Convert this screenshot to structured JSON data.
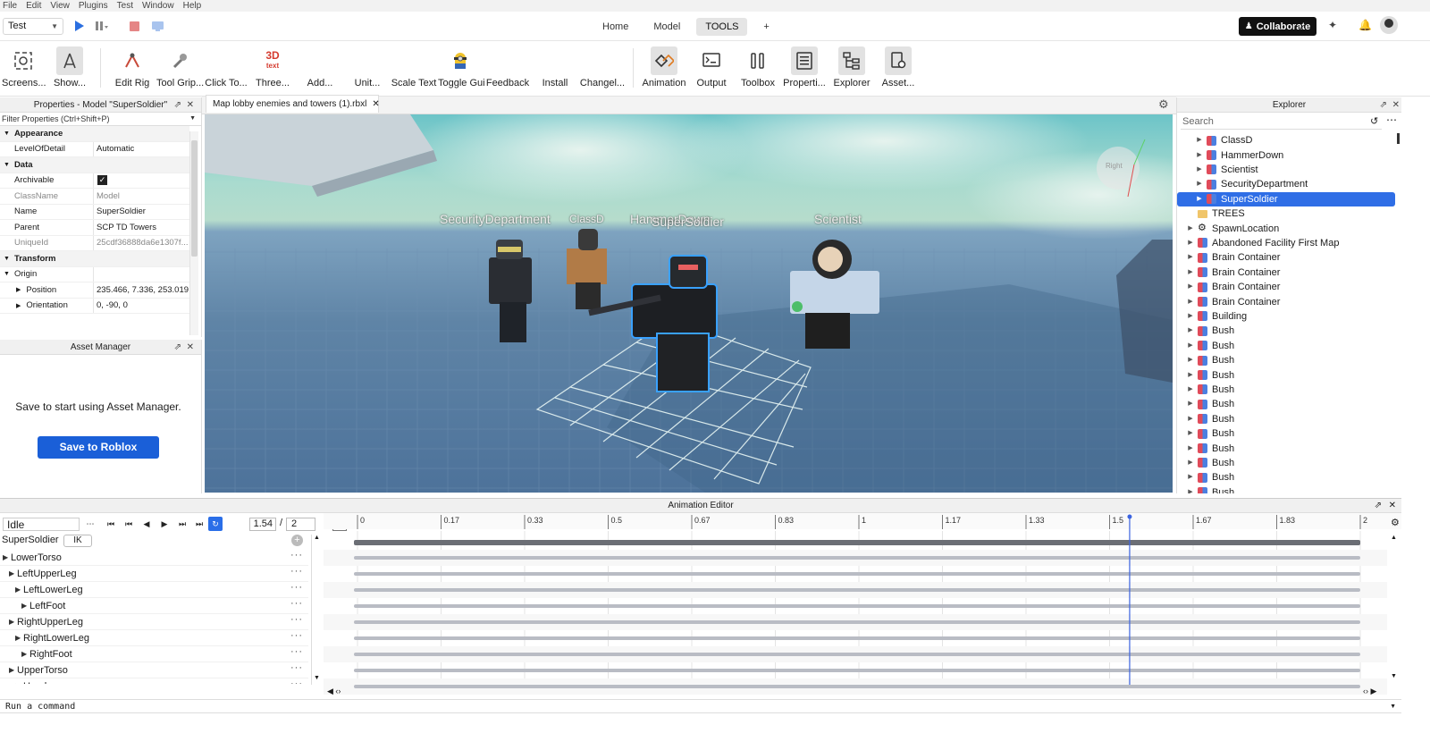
{
  "menu": [
    "File",
    "Edit",
    "View",
    "Plugins",
    "Test",
    "Window",
    "Help"
  ],
  "header": {
    "mode": "Test",
    "tabs": [
      "Home",
      "Model",
      "TOOLS",
      "+"
    ],
    "collaborate": "Collaborate"
  },
  "ribbon": [
    "Screens...",
    "Show...",
    "Edit Rig",
    "Tool Grip...",
    "Click To...",
    "Three...",
    "Add...",
    "Unit...",
    "Scale Text",
    "Toggle Gui",
    "Feedback",
    "Install",
    "Changel...",
    "Animation",
    "Output",
    "Toolbox",
    "Properti...",
    "Explorer",
    "Asset..."
  ],
  "properties": {
    "title": "Properties - Model \"SuperSoldier\"",
    "filter": "Filter Properties (Ctrl+Shift+P)",
    "rows": [
      {
        "k": "Appearance"
      },
      {
        "k": "LevelOfDetail",
        "v": "Automatic"
      },
      {
        "k": "Data"
      },
      {
        "k": "Archivable",
        "v": "checked"
      },
      {
        "k": "ClassName",
        "v": "Model"
      },
      {
        "k": "Name",
        "v": "SuperSoldier"
      },
      {
        "k": "Parent",
        "v": "SCP TD Towers"
      },
      {
        "k": "UniqueId",
        "v": "25cdf36888da6e1307f..."
      },
      {
        "k": "Transform"
      },
      {
        "k": "Origin"
      },
      {
        "k": "Position",
        "v": "235.466, 7.336, 253.019"
      },
      {
        "k": "Orientation",
        "v": "0, -90, 0"
      }
    ]
  },
  "asset_manager": {
    "title": "Asset Manager",
    "message": "Save to start using Asset Manager.",
    "button": "Save to Roblox"
  },
  "viewport": {
    "doc_tab": "Map lobby enemies and towers (1).rbxl",
    "labels": [
      "SecurityDepartment",
      "ClassD",
      "HammerDown",
      "SuperSoldier",
      "Scientist"
    ],
    "gizmo": "Right"
  },
  "explorer": {
    "title": "Explorer",
    "search_placeholder": "Search",
    "items": [
      {
        "label": "ClassD",
        "indent": 2,
        "icon": "model",
        "arrow": true
      },
      {
        "label": "HammerDown",
        "indent": 2,
        "icon": "model",
        "arrow": true
      },
      {
        "label": "Scientist",
        "indent": 2,
        "icon": "model",
        "arrow": true
      },
      {
        "label": "SecurityDepartment",
        "indent": 2,
        "icon": "model",
        "arrow": true
      },
      {
        "label": "SuperSoldier",
        "indent": 2,
        "icon": "model",
        "arrow": true,
        "selected": true
      },
      {
        "label": "TREES",
        "indent": 1,
        "icon": "folder",
        "arrow": false
      },
      {
        "label": "SpawnLocation",
        "indent": 1,
        "icon": "spawn",
        "arrow": true
      },
      {
        "label": "Abandoned Facility First Map",
        "indent": 1,
        "icon": "model",
        "arrow": true
      },
      {
        "label": "Brain Container",
        "indent": 1,
        "icon": "model",
        "arrow": true
      },
      {
        "label": "Brain Container",
        "indent": 1,
        "icon": "model",
        "arrow": true
      },
      {
        "label": "Brain Container",
        "indent": 1,
        "icon": "model",
        "arrow": true
      },
      {
        "label": "Brain Container",
        "indent": 1,
        "icon": "model",
        "arrow": true
      },
      {
        "label": "Building",
        "indent": 1,
        "icon": "model",
        "arrow": true
      },
      {
        "label": "Bush",
        "indent": 1,
        "icon": "model",
        "arrow": true
      },
      {
        "label": "Bush",
        "indent": 1,
        "icon": "model",
        "arrow": true
      },
      {
        "label": "Bush",
        "indent": 1,
        "icon": "model",
        "arrow": true
      },
      {
        "label": "Bush",
        "indent": 1,
        "icon": "model",
        "arrow": true
      },
      {
        "label": "Bush",
        "indent": 1,
        "icon": "model",
        "arrow": true
      },
      {
        "label": "Bush",
        "indent": 1,
        "icon": "model",
        "arrow": true
      },
      {
        "label": "Bush",
        "indent": 1,
        "icon": "model",
        "arrow": true
      },
      {
        "label": "Bush",
        "indent": 1,
        "icon": "model",
        "arrow": true
      },
      {
        "label": "Bush",
        "indent": 1,
        "icon": "model",
        "arrow": true
      },
      {
        "label": "Bush",
        "indent": 1,
        "icon": "model",
        "arrow": true
      },
      {
        "label": "Bush",
        "indent": 1,
        "icon": "model",
        "arrow": true
      },
      {
        "label": "Bush",
        "indent": 1,
        "icon": "model",
        "arrow": true
      }
    ]
  },
  "animation": {
    "title": "Animation Editor",
    "name": "Idle",
    "current_time": "1.54",
    "separator": "/",
    "length": "2",
    "rig": "SuperSoldier",
    "ik": "IK",
    "tracks": [
      {
        "label": "LowerTorso",
        "level": 0
      },
      {
        "label": "LeftUpperLeg",
        "level": 1
      },
      {
        "label": "LeftLowerLeg",
        "level": 2
      },
      {
        "label": "LeftFoot",
        "level": 3
      },
      {
        "label": "RightUpperLeg",
        "level": 1
      },
      {
        "label": "RightLowerLeg",
        "level": 2
      },
      {
        "label": "RightFoot",
        "level": 3
      },
      {
        "label": "UpperTorso",
        "level": 1
      },
      {
        "label": "Head",
        "level": 2
      }
    ],
    "ticks": [
      "0",
      "0.17",
      "0.33",
      "0.5",
      "0.67",
      "0.83",
      "1",
      "1.17",
      "1.33",
      "1.5",
      "1.67",
      "1.83",
      "2"
    ],
    "max_time": 2,
    "scrubber_time": 1.54,
    "scrubber_color": "#3b63e0"
  },
  "command_bar": {
    "placeholder": "Run a command"
  },
  "colors": {
    "accent": "#2f6ee6",
    "save_button": "#1a5fd8"
  }
}
